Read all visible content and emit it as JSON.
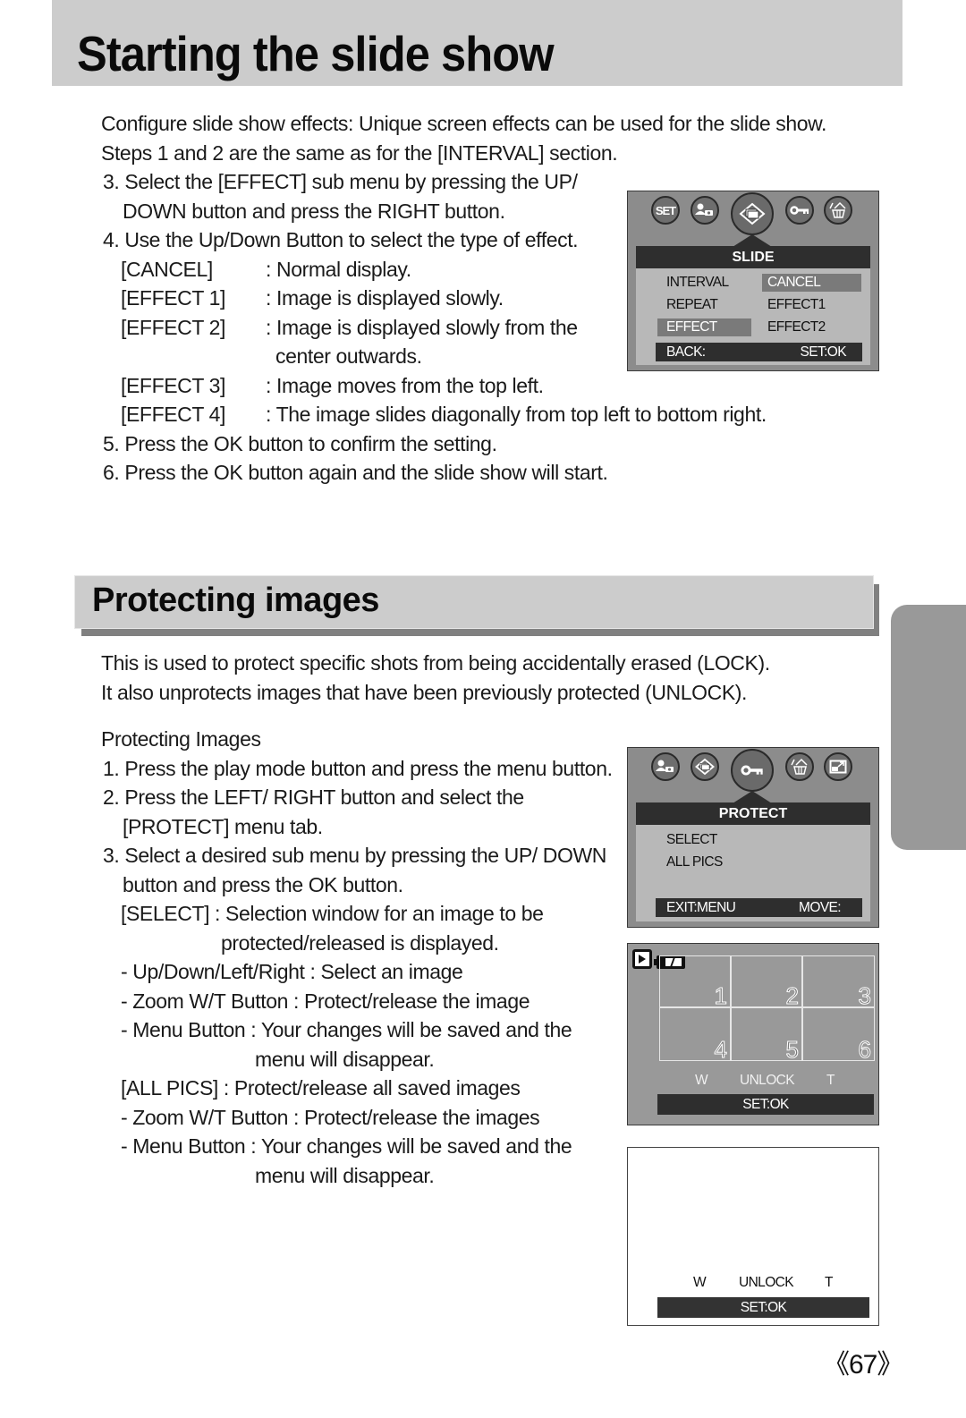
{
  "section1": {
    "title": "Starting the slide show",
    "intro": [
      "Configure slide show effects: Unique screen effects can be used for the slide show.",
      "Steps 1 and 2 are the same as for the [INTERVAL] section."
    ],
    "step3": [
      "3. Select the [EFFECT] sub menu by pressing the UP/",
      "DOWN button and press the RIGHT button."
    ],
    "step4": "4. Use the Up/Down Button to select the type of effect.",
    "effects": [
      {
        "term": "[CANCEL]",
        "desc": ": Normal display."
      },
      {
        "term": "[EFFECT 1]",
        "desc": ": Image is displayed slowly."
      },
      {
        "term": "[EFFECT 2]",
        "desc": ": Image is displayed slowly from the",
        "cont": "center outwards."
      },
      {
        "term": "[EFFECT 3]",
        "desc": ": Image moves from the top left."
      },
      {
        "term": "[EFFECT 4]",
        "desc": ": The image slides diagonally from top left to bottom right."
      }
    ],
    "step5": "5. Press the OK button to confirm the setting.",
    "step6": "6. Press the OK button again and the slide show will start."
  },
  "slide_menu": {
    "icons": [
      "set-icon",
      "person-camera-icon",
      "slideshow-icon",
      "key-icon",
      "delete-basket-icon"
    ],
    "set_label": "SET",
    "header": "SLIDE",
    "left_items": [
      "INTERVAL",
      "REPEAT",
      "EFFECT"
    ],
    "right_items": [
      "CANCEL",
      "EFFECT1",
      "EFFECT2"
    ],
    "selected_left": "EFFECT",
    "selected_right": "CANCEL",
    "footer_left": "BACK:",
    "footer_right": "SET:OK"
  },
  "section2": {
    "title": "Protecting images",
    "intro": [
      "This is used to protect specific shots from being accidentally erased (LOCK).",
      "It also unprotects images that have been previously protected (UNLOCK)."
    ],
    "subheading": "Protecting Images",
    "step1": "1. Press the play mode button and press the menu button.",
    "step2": [
      "2. Press the LEFT/ RIGHT button and select the",
      "[PROTECT] menu tab."
    ],
    "step3": [
      "3. Select a desired sub menu by pressing the UP/ DOWN",
      "button and press the OK button."
    ],
    "select": {
      "term": "[SELECT] : Selection window for an image to be",
      "cont": "protected/released is displayed."
    },
    "select_bullets": [
      "- Up/Down/Left/Right : Select an image",
      "- Zoom W/T Button : Protect/release the image",
      "- Menu Button : Your changes will be saved and the"
    ],
    "select_bullets_cont": "menu will disappear.",
    "allpics": "[ALL PICS] : Protect/release all saved images",
    "allpics_bullets": [
      "- Zoom W/T Button : Protect/release the images",
      "- Menu Button : Your changes will be saved and the"
    ],
    "allpics_bullets_cont": "menu will disappear."
  },
  "protect_menu": {
    "icons": [
      "person-camera-icon",
      "slideshow-icon",
      "key-icon",
      "delete-basket-icon",
      "resize-icon"
    ],
    "header": "PROTECT",
    "items": [
      "SELECT",
      "ALL PICS"
    ],
    "footer_left": "EXIT:MENU",
    "footer_right": "MOVE:"
  },
  "thumbnail_screen": {
    "cells": [
      "1",
      "2",
      "3",
      "4",
      "5",
      "6"
    ],
    "w": "W",
    "state": "UNLOCK",
    "t": "T",
    "footer": "SET:OK"
  },
  "blank_screen": {
    "w": "W",
    "state": "UNLOCK",
    "t": "T",
    "footer": "SET:OK"
  },
  "page_number": "《67》",
  "colors": {
    "band": "#cccccc",
    "band_shadow": "#808080",
    "lcd_bg": "#8c8c8c",
    "lcd_dark": "#2e2e2e",
    "lcd_panel": "#b8b8b8",
    "side_tab": "#999999"
  }
}
